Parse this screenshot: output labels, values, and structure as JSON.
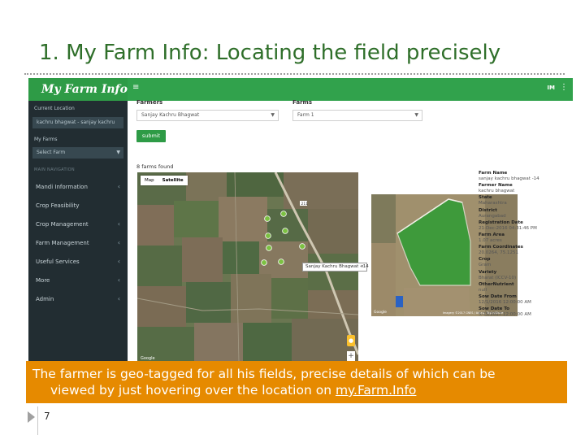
{
  "slide": {
    "title": "1. My Farm Info: Locating the field precisely",
    "caption": {
      "line1": "The farmer is geo-tagged for all his fields, precise details of which can be",
      "line2_prefix": "viewed by just hovering over the location on ",
      "link": "my.Farm.Info"
    },
    "page_number": "7"
  },
  "app": {
    "brand": "My Farm Info",
    "topbar": {
      "menu_icon": "menu-icon",
      "user_initials": "IM",
      "more_icon": "more-vertical-icon"
    },
    "sidebar": {
      "current_location_label": "Current Location",
      "current_location_value": "kachru bhagwat - sanjay kachru",
      "my_farms_label": "My Farms",
      "my_farms_value": "Select Farm",
      "section_label": "MAIN NAVIGATION",
      "items": [
        {
          "label": "Mandi Information"
        },
        {
          "label": "Crop Feasibility"
        },
        {
          "label": "Crop Management"
        },
        {
          "label": "Farm Management"
        },
        {
          "label": "Useful Services"
        },
        {
          "label": "More"
        },
        {
          "label": "Admin"
        }
      ]
    },
    "filters": {
      "farmers_label": "Farmers",
      "farmers_value": "Sanjay Kachru Bhagwat",
      "farms_label": "Farms",
      "farms_value": "Farm 1",
      "submit_label": "submit"
    },
    "farms_found": "8 farms found",
    "map": {
      "tab_map": "Map",
      "tab_satellite": "Satellite",
      "road_label": "211",
      "tooltip": "Sanjay Kachru Bhagwat - 14",
      "tooltip_close": "×",
      "google_label": "Google",
      "marker_count": 8
    },
    "aerial": {
      "google_label": "Google",
      "attribution": "Imagery ©2017 CNES / Airbus, DigitalGlobe"
    },
    "farm_details": [
      {
        "key": "Farm Name",
        "value": "sanjay kachru bhagwat -14"
      },
      {
        "key": "Farmer Name",
        "value": "kachru bhagwat"
      },
      {
        "key": "State",
        "value": "Maharashtra"
      },
      {
        "key": "District",
        "value": "Aurangabad"
      },
      {
        "key": "Registration Date",
        "value": "21-Dec-2016 04:31:46 PM"
      },
      {
        "key": "Farm Area",
        "value": "1.07 acres"
      },
      {
        "key": "Farm Coordinates",
        "value": "20.0264, 75.1251"
      },
      {
        "key": "Crop",
        "value": "Gram"
      },
      {
        "key": "Variety",
        "value": "Bharat (ICCV-10)"
      },
      {
        "key": "OtherNutrient",
        "value": "null"
      },
      {
        "key": "Sow Date From",
        "value": "12/1/2016 12:00:00 AM"
      },
      {
        "key": "Sow Date To",
        "value": "5/15/2017 12:00:00 AM"
      }
    ]
  }
}
